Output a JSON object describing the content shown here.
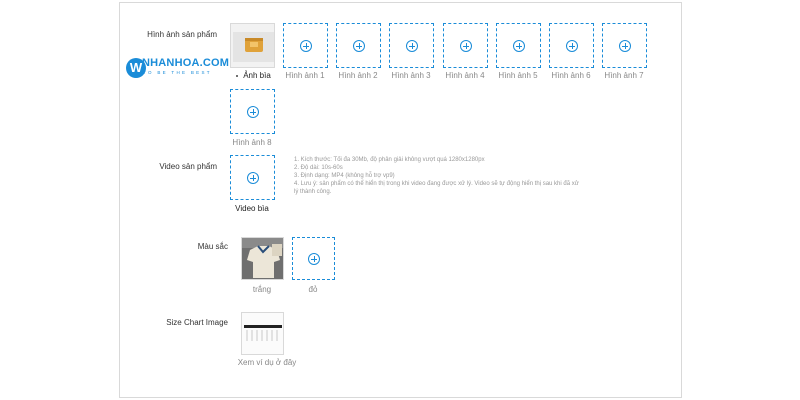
{
  "logo": {
    "brand": "NHANHOA.COM",
    "tagline": "TO BE THE BEST",
    "mark": "W"
  },
  "product_images": {
    "label": "Hình ảnh sản phẩm",
    "cover_caption": "Ảnh bìa",
    "slots": [
      "Hình ảnh 1",
      "Hình ảnh 2",
      "Hình ảnh 3",
      "Hình ảnh 4",
      "Hình ảnh 5",
      "Hình ảnh 6",
      "Hình ảnh 7",
      "Hình ảnh 8"
    ]
  },
  "video": {
    "label": "Video sản phẩm",
    "slot_caption": "Video bìa",
    "notes": [
      "1. Kích thước: Tối đa 30Mb, độ phân giải không vượt quá 1280x1280px",
      "2. Độ dài: 10s-60s",
      "3. Định dạng: MP4 (không hỗ trợ vp9)",
      "4. Lưu ý: sản phẩm có thể hiển thị trong khi video đang được xử lý. Video sẽ tự động hiển thị sau khi đã xử lý thành công."
    ]
  },
  "colors": {
    "label": "Màu sắc",
    "items": [
      {
        "caption": "trắng"
      },
      {
        "caption": "đỏ"
      }
    ]
  },
  "size_chart": {
    "label": "Size Chart Image",
    "caption": "Xem ví dụ ở đây"
  },
  "colors_theme": {
    "accent": "#1a8cd8",
    "border": "#d9d9d9"
  }
}
